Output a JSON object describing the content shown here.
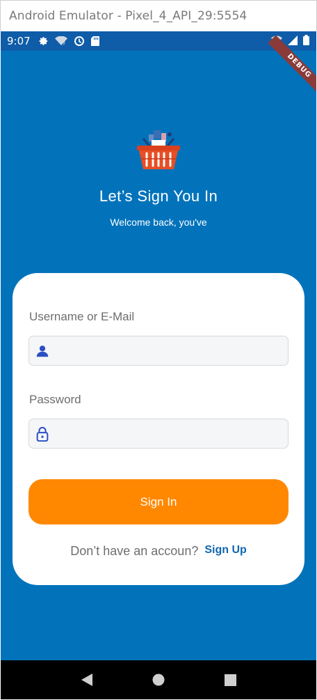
{
  "window": {
    "title": "Android Emulator - Pixel_4_API_29:5554"
  },
  "status_bar": {
    "time": "9:07",
    "icons": [
      "gear-icon",
      "wifi-question-icon",
      "sync-icon",
      "sd-card-icon",
      "wifi-signal-icon",
      "cell-signal-icon",
      "battery-icon"
    ]
  },
  "debug_banner": "DEBUG",
  "login": {
    "logo_icon": "shopping-basket-icon",
    "title": "Let’s Sign You In",
    "subtitle": "Welcome back, you've",
    "username": {
      "label": "Username or E-Mail",
      "value": "",
      "icon": "person-icon"
    },
    "password": {
      "label": "Password",
      "value": "",
      "icon": "lock-icon"
    },
    "sign_in_label": "Sign In",
    "signup_prompt": "Don’t have an accoun?",
    "signup_link": "Sign Up"
  },
  "nav": {
    "back": "back-icon",
    "home": "home-icon",
    "recents": "recents-icon"
  },
  "colors": {
    "background": "#0273bb",
    "status_bar": "#0f5ca8",
    "button": "#ff8800",
    "link": "#0f67b0",
    "icon_blue": "#2a4fc4"
  }
}
